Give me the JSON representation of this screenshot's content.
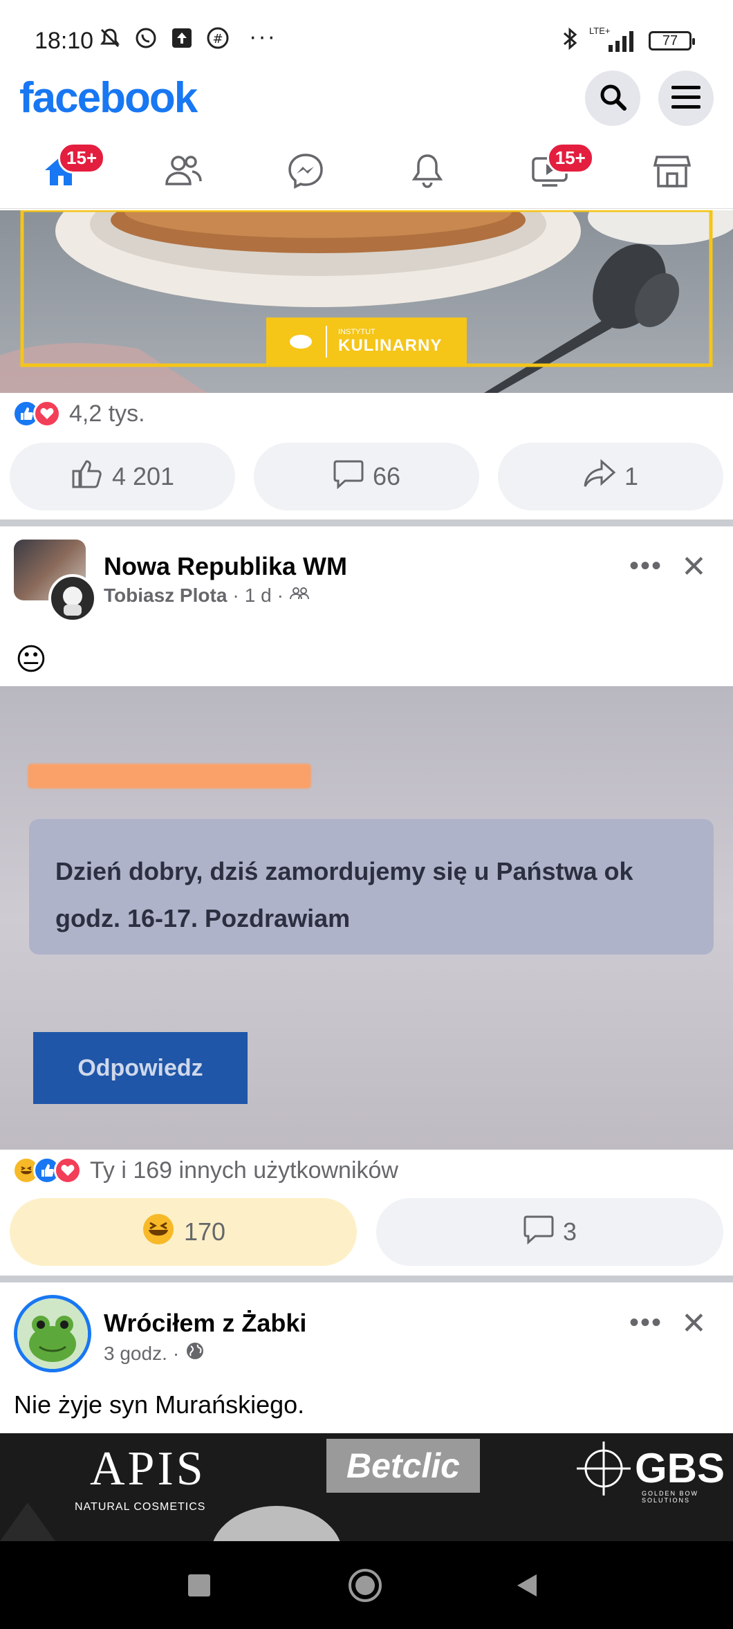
{
  "status": {
    "time": "18:10",
    "more": "···",
    "network": "LTE+",
    "battery": "77"
  },
  "header": {
    "logo": "facebook",
    "search_icon": "search-icon",
    "menu_icon": "hamburger-menu-icon"
  },
  "tabs": [
    {
      "name": "home",
      "icon": "home-icon",
      "badge": "15+"
    },
    {
      "name": "friends",
      "icon": "friends-icon",
      "badge": ""
    },
    {
      "name": "messenger",
      "icon": "messenger-icon",
      "badge": ""
    },
    {
      "name": "notifications",
      "icon": "bell-icon",
      "badge": ""
    },
    {
      "name": "watch",
      "icon": "video-icon",
      "badge": "15+"
    },
    {
      "name": "marketplace",
      "icon": "shop-icon",
      "badge": ""
    }
  ],
  "post1": {
    "ad_brand_small": "INSTYTUT",
    "ad_brand_big": "KULINARNY",
    "reactions_summary": "4,2 tys.",
    "like_count": "4 201",
    "comment_count": "66",
    "share_count": "1"
  },
  "post2": {
    "group": "Nowa Republika WM",
    "author": "Tobiasz Plota",
    "time": "1 d",
    "emoji": "😐",
    "photo_message": "Dzień dobry, dziś zamordujemy się u Państwa ok godz. 16-17. Pozdrawiam",
    "photo_button": "Odpowiedz",
    "reactions_summary": "Ty i 169 innych użytkowników",
    "haha_count": "170",
    "comment_count": "3"
  },
  "post3": {
    "author": "Wróciłem z Żabki",
    "time": "3 godz.",
    "text": "Nie żyje syn Murańskiego.",
    "sponsors": {
      "apis": "APIS",
      "apis_sub": "NATURAL COSMETICS",
      "betclic": "Betclic",
      "gbs": "GBS",
      "gbs_sub": "GOLDEN BOW SOLUTIONS"
    }
  },
  "colors": {
    "fb_blue": "#1877f2",
    "badge_red": "#e41e3f",
    "haha_bg": "#fdf0c8"
  }
}
